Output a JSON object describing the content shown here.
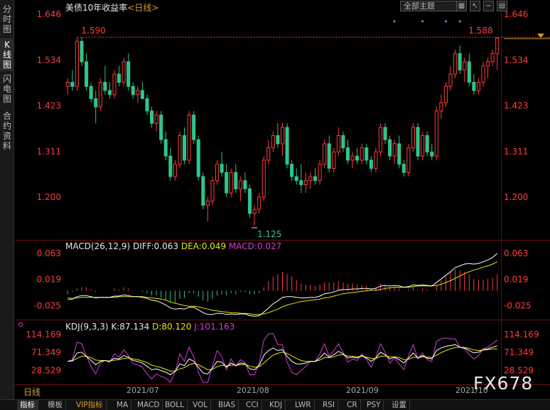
{
  "left_tabs": [
    {
      "label": "分时图",
      "chars": [
        "分",
        "时",
        "图"
      ],
      "active": false
    },
    {
      "label": "K线图",
      "chars": [
        "K",
        "线",
        "图"
      ],
      "active": true
    },
    {
      "label": "闪电图",
      "chars": [
        "闪",
        "电",
        "图"
      ],
      "active": false
    },
    {
      "label": "合约资料",
      "chars": [
        "合",
        "约",
        "资",
        "料"
      ],
      "active": false
    }
  ],
  "header": {
    "title": "美债10年收益率",
    "period": "<日线>",
    "theme_select": "全部主题",
    "icons": [
      "grid-icon",
      "pointer-icon",
      "minus-icon",
      "settings-icon"
    ]
  },
  "price_axis": {
    "ticks": [
      "1.646",
      "1.534",
      "1.423",
      "1.311",
      "1.200"
    ],
    "high_label": "1.590",
    "low_label": "1.125",
    "last_label": "1.588"
  },
  "macd": {
    "label": "MACD(26,12,9)",
    "diff": "DIFF:0.063",
    "dea": "DEA:0.049",
    "macd": "MACD:0.027",
    "ticks": [
      "0.063",
      "0.019",
      "-0.025"
    ]
  },
  "kdj": {
    "label": "KDJ(9,3,3)",
    "k": "K:87.134",
    "d": "D:80.120",
    "j": "J:101.163",
    "ticks": [
      "114.169",
      "71.349",
      "28.529"
    ]
  },
  "date_axis": {
    "period_tab": "日线",
    "labels": [
      "2021/07",
      "2021/08",
      "2021/09",
      "2021/10"
    ]
  },
  "bottom_tabs": [
    "指标",
    "模板",
    "VIP指标",
    "MA",
    "MACD",
    "BOLL",
    "VOL",
    "BIAS",
    "CCI",
    "KDJ",
    "LWR",
    "RSI",
    "CR",
    "PSY",
    "设置"
  ],
  "watermark": "FX678",
  "colors": {
    "up": "#ff3b3b",
    "down": "#2ec48a",
    "diff": "#ffffff",
    "dea": "#e6e600",
    "macd": "#d23cd2",
    "accent": "#d4a030"
  },
  "chart_data": {
    "type": "candlestick",
    "ohlc": [
      [
        1.47,
        1.49,
        1.45,
        1.48
      ],
      [
        1.48,
        1.51,
        1.46,
        1.47
      ],
      [
        1.47,
        1.59,
        1.46,
        1.58
      ],
      [
        1.58,
        1.59,
        1.52,
        1.53
      ],
      [
        1.53,
        1.55,
        1.46,
        1.47
      ],
      [
        1.47,
        1.48,
        1.43,
        1.44
      ],
      [
        1.44,
        1.46,
        1.38,
        1.42
      ],
      [
        1.42,
        1.49,
        1.41,
        1.48
      ],
      [
        1.48,
        1.52,
        1.45,
        1.46
      ],
      [
        1.46,
        1.48,
        1.44,
        1.45
      ],
      [
        1.45,
        1.51,
        1.44,
        1.5
      ],
      [
        1.5,
        1.52,
        1.47,
        1.48
      ],
      [
        1.48,
        1.54,
        1.47,
        1.53
      ],
      [
        1.53,
        1.55,
        1.46,
        1.47
      ],
      [
        1.47,
        1.48,
        1.44,
        1.45
      ],
      [
        1.45,
        1.47,
        1.43,
        1.46
      ],
      [
        1.46,
        1.48,
        1.44,
        1.44
      ],
      [
        1.44,
        1.45,
        1.4,
        1.41
      ],
      [
        1.41,
        1.42,
        1.37,
        1.38
      ],
      [
        1.38,
        1.41,
        1.36,
        1.4
      ],
      [
        1.4,
        1.41,
        1.33,
        1.34
      ],
      [
        1.34,
        1.36,
        1.29,
        1.3
      ],
      [
        1.3,
        1.32,
        1.24,
        1.25
      ],
      [
        1.25,
        1.29,
        1.24,
        1.28
      ],
      [
        1.28,
        1.36,
        1.27,
        1.35
      ],
      [
        1.35,
        1.37,
        1.28,
        1.29
      ],
      [
        1.29,
        1.41,
        1.28,
        1.4
      ],
      [
        1.4,
        1.41,
        1.33,
        1.34
      ],
      [
        1.34,
        1.35,
        1.24,
        1.25
      ],
      [
        1.25,
        1.26,
        1.17,
        1.18
      ],
      [
        1.18,
        1.2,
        1.14,
        1.19
      ],
      [
        1.19,
        1.25,
        1.18,
        1.24
      ],
      [
        1.24,
        1.29,
        1.23,
        1.28
      ],
      [
        1.28,
        1.31,
        1.25,
        1.26
      ],
      [
        1.26,
        1.28,
        1.2,
        1.21
      ],
      [
        1.21,
        1.27,
        1.2,
        1.26
      ],
      [
        1.26,
        1.28,
        1.21,
        1.22
      ],
      [
        1.22,
        1.25,
        1.19,
        1.24
      ],
      [
        1.24,
        1.26,
        1.21,
        1.22
      ],
      [
        1.22,
        1.23,
        1.15,
        1.16
      ],
      [
        1.16,
        1.18,
        1.13,
        1.17
      ],
      [
        1.17,
        1.21,
        1.16,
        1.2
      ],
      [
        1.2,
        1.3,
        1.19,
        1.29
      ],
      [
        1.29,
        1.34,
        1.28,
        1.32
      ],
      [
        1.32,
        1.36,
        1.31,
        1.35
      ],
      [
        1.35,
        1.38,
        1.32,
        1.33
      ],
      [
        1.33,
        1.38,
        1.3,
        1.37
      ],
      [
        1.37,
        1.38,
        1.27,
        1.28
      ],
      [
        1.28,
        1.29,
        1.24,
        1.25
      ],
      [
        1.25,
        1.27,
        1.23,
        1.24
      ],
      [
        1.24,
        1.28,
        1.21,
        1.23
      ],
      [
        1.23,
        1.26,
        1.21,
        1.24
      ],
      [
        1.24,
        1.26,
        1.22,
        1.25
      ],
      [
        1.25,
        1.27,
        1.23,
        1.24
      ],
      [
        1.24,
        1.29,
        1.23,
        1.28
      ],
      [
        1.28,
        1.34,
        1.27,
        1.33
      ],
      [
        1.33,
        1.35,
        1.26,
        1.27
      ],
      [
        1.27,
        1.32,
        1.26,
        1.31
      ],
      [
        1.31,
        1.37,
        1.3,
        1.35
      ],
      [
        1.35,
        1.36,
        1.31,
        1.32
      ],
      [
        1.32,
        1.34,
        1.28,
        1.29
      ],
      [
        1.29,
        1.31,
        1.27,
        1.3
      ],
      [
        1.3,
        1.32,
        1.28,
        1.29
      ],
      [
        1.29,
        1.33,
        1.28,
        1.32
      ],
      [
        1.32,
        1.33,
        1.28,
        1.29
      ],
      [
        1.29,
        1.3,
        1.26,
        1.27
      ],
      [
        1.27,
        1.32,
        1.26,
        1.31
      ],
      [
        1.31,
        1.38,
        1.3,
        1.37
      ],
      [
        1.37,
        1.38,
        1.33,
        1.34
      ],
      [
        1.34,
        1.35,
        1.29,
        1.3
      ],
      [
        1.3,
        1.34,
        1.28,
        1.33
      ],
      [
        1.33,
        1.35,
        1.27,
        1.28
      ],
      [
        1.28,
        1.29,
        1.25,
        1.26
      ],
      [
        1.26,
        1.33,
        1.25,
        1.32
      ],
      [
        1.32,
        1.38,
        1.31,
        1.37
      ],
      [
        1.37,
        1.38,
        1.29,
        1.3
      ],
      [
        1.3,
        1.36,
        1.29,
        1.35
      ],
      [
        1.35,
        1.36,
        1.3,
        1.31
      ],
      [
        1.31,
        1.33,
        1.29,
        1.3
      ],
      [
        1.3,
        1.42,
        1.29,
        1.41
      ],
      [
        1.41,
        1.45,
        1.39,
        1.43
      ],
      [
        1.43,
        1.48,
        1.42,
        1.47
      ],
      [
        1.47,
        1.52,
        1.46,
        1.5
      ],
      [
        1.5,
        1.56,
        1.49,
        1.55
      ],
      [
        1.55,
        1.57,
        1.5,
        1.51
      ],
      [
        1.51,
        1.54,
        1.48,
        1.53
      ],
      [
        1.53,
        1.55,
        1.47,
        1.48
      ],
      [
        1.48,
        1.5,
        1.45,
        1.46
      ],
      [
        1.46,
        1.49,
        1.45,
        1.48
      ],
      [
        1.48,
        1.53,
        1.47,
        1.52
      ],
      [
        1.52,
        1.54,
        1.49,
        1.53
      ],
      [
        1.53,
        1.56,
        1.52,
        1.55
      ],
      [
        1.55,
        1.59,
        1.51,
        1.588
      ]
    ],
    "ylim": [
      1.125,
      1.646
    ],
    "high": 1.59,
    "low": 1.125,
    "last": 1.588,
    "macd_diff": [
      -0.015,
      -0.014,
      -0.01,
      -0.008,
      -0.008,
      -0.01,
      -0.012,
      -0.011,
      -0.011,
      -0.011,
      -0.009,
      -0.009,
      -0.007,
      -0.008,
      -0.01,
      -0.01,
      -0.011,
      -0.013,
      -0.016,
      -0.017,
      -0.02,
      -0.024,
      -0.029,
      -0.031,
      -0.03,
      -0.031,
      -0.028,
      -0.028,
      -0.032,
      -0.037,
      -0.04,
      -0.04,
      -0.038,
      -0.038,
      -0.04,
      -0.039,
      -0.04,
      -0.039,
      -0.039,
      -0.042,
      -0.043,
      -0.042,
      -0.036,
      -0.029,
      -0.022,
      -0.017,
      -0.011,
      -0.01,
      -0.01,
      -0.011,
      -0.012,
      -0.012,
      -0.011,
      -0.011,
      -0.009,
      -0.005,
      -0.004,
      -0.002,
      0.001,
      0.002,
      0.002,
      0.003,
      0.003,
      0.004,
      0.004,
      0.003,
      0.004,
      0.008,
      0.009,
      0.008,
      0.009,
      0.008,
      0.006,
      0.007,
      0.01,
      0.009,
      0.01,
      0.009,
      0.008,
      0.014,
      0.02,
      0.026,
      0.032,
      0.039,
      0.042,
      0.045,
      0.046,
      0.045,
      0.046,
      0.049,
      0.052,
      0.056,
      0.063
    ],
    "macd_dea": [
      -0.012,
      -0.013,
      -0.012,
      -0.011,
      -0.011,
      -0.011,
      -0.011,
      -0.011,
      -0.011,
      -0.011,
      -0.011,
      -0.01,
      -0.01,
      -0.01,
      -0.01,
      -0.01,
      -0.01,
      -0.011,
      -0.012,
      -0.013,
      -0.014,
      -0.016,
      -0.019,
      -0.021,
      -0.023,
      -0.025,
      -0.026,
      -0.026,
      -0.027,
      -0.029,
      -0.031,
      -0.033,
      -0.034,
      -0.035,
      -0.036,
      -0.037,
      -0.037,
      -0.038,
      -0.038,
      -0.039,
      -0.04,
      -0.04,
      -0.039,
      -0.037,
      -0.034,
      -0.031,
      -0.027,
      -0.024,
      -0.022,
      -0.02,
      -0.018,
      -0.017,
      -0.016,
      -0.015,
      -0.014,
      -0.012,
      -0.011,
      -0.009,
      -0.007,
      -0.005,
      -0.004,
      -0.003,
      -0.002,
      -0.001,
      0.0,
      0.001,
      0.001,
      0.002,
      0.004,
      0.005,
      0.006,
      0.006,
      0.006,
      0.006,
      0.007,
      0.008,
      0.008,
      0.008,
      0.008,
      0.009,
      0.011,
      0.014,
      0.017,
      0.021,
      0.025,
      0.029,
      0.032,
      0.035,
      0.037,
      0.04,
      0.042,
      0.045,
      0.049
    ],
    "kdj_k": [
      50,
      52,
      70,
      72,
      62,
      52,
      42,
      50,
      52,
      50,
      58,
      56,
      64,
      60,
      52,
      50,
      46,
      38,
      30,
      32,
      28,
      24,
      18,
      26,
      44,
      40,
      56,
      50,
      36,
      22,
      20,
      34,
      50,
      48,
      36,
      46,
      40,
      46,
      44,
      32,
      30,
      40,
      64,
      76,
      82,
      76,
      78,
      62,
      50,
      44,
      44,
      46,
      50,
      50,
      58,
      70,
      60,
      66,
      74,
      68,
      58,
      60,
      58,
      64,
      58,
      50,
      58,
      72,
      66,
      56,
      60,
      54,
      46,
      58,
      70,
      58,
      64,
      58,
      56,
      76,
      82,
      86,
      88,
      90,
      84,
      82,
      76,
      70,
      72,
      78,
      80,
      84,
      87
    ],
    "kdj_d": [
      50,
      51,
      57,
      62,
      62,
      59,
      53,
      52,
      52,
      51,
      53,
      54,
      57,
      58,
      56,
      54,
      51,
      47,
      41,
      38,
      35,
      31,
      27,
      27,
      32,
      35,
      42,
      45,
      42,
      36,
      30,
      31,
      37,
      41,
      39,
      41,
      41,
      42,
      43,
      39,
      36,
      37,
      46,
      56,
      65,
      69,
      72,
      69,
      63,
      57,
      52,
      50,
      50,
      50,
      53,
      59,
      59,
      61,
      65,
      66,
      63,
      62,
      61,
      62,
      60,
      57,
      57,
      62,
      63,
      61,
      61,
      59,
      54,
      55,
      60,
      59,
      61,
      60,
      59,
      65,
      71,
      76,
      80,
      83,
      84,
      83,
      81,
      77,
      76,
      77,
      78,
      80,
      80
    ],
    "kdj_j": [
      50,
      54,
      96,
      92,
      62,
      38,
      20,
      46,
      52,
      48,
      68,
      60,
      78,
      64,
      44,
      42,
      36,
      20,
      8,
      20,
      14,
      10,
      0,
      24,
      68,
      50,
      84,
      60,
      24,
      0,
      0,
      40,
      76,
      62,
      30,
      56,
      38,
      54,
      46,
      18,
      18,
      46,
      100,
      116,
      116,
      90,
      90,
      48,
      24,
      18,
      28,
      38,
      50,
      50,
      68,
      92,
      62,
      76,
      92,
      72,
      48,
      56,
      52,
      68,
      54,
      36,
      60,
      92,
      72,
      46,
      58,
      44,
      30,
      64,
      90,
      56,
      70,
      54,
      50,
      98,
      104,
      106,
      104,
      104,
      84,
      80,
      66,
      56,
      64,
      80,
      84,
      92,
      101
    ]
  }
}
